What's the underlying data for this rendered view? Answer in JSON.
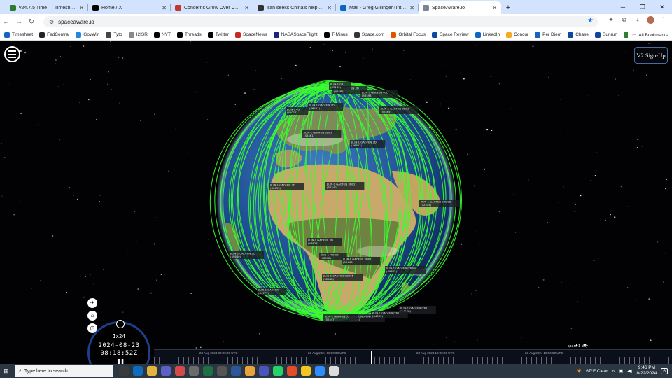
{
  "tabs": [
    {
      "title": "v24.7.5 Time — Timesheet for ",
      "color": "#2e7d32",
      "active": false
    },
    {
      "title": "Home / X",
      "color": "#000000",
      "active": false
    },
    {
      "title": "Concerns Grow Over Chinese S",
      "color": "#c0392b",
      "active": false
    },
    {
      "title": "Iran seeks China's help with su",
      "color": "#333333",
      "active": false
    },
    {
      "title": "Mail - Greg Gillinger (Integrity",
      "color": "#0a66c2",
      "active": false
    },
    {
      "title": "SpaceAware.io",
      "color": "#7a8599",
      "active": true
    }
  ],
  "address": {
    "url": "spaceaware.io"
  },
  "bookmarks": [
    {
      "label": "Timesheet",
      "color": "#1565c0"
    },
    {
      "label": "FedCentral",
      "color": "#222222"
    },
    {
      "label": "GovWin",
      "color": "#1e88e5"
    },
    {
      "label": "Tyto",
      "color": "#444444"
    },
    {
      "label": "I2ISR",
      "color": "#888888"
    },
    {
      "label": "NYT",
      "color": "#000000"
    },
    {
      "label": "Threads",
      "color": "#000000"
    },
    {
      "label": "Twitter",
      "color": "#000000"
    },
    {
      "label": "SpaceNews",
      "color": "#c62828"
    },
    {
      "label": "NASASpaceFlight",
      "color": "#1a237e"
    },
    {
      "label": "T-Minus",
      "color": "#000000"
    },
    {
      "label": "Space.com",
      "color": "#333333"
    },
    {
      "label": "Orbital Focus",
      "color": "#e65100"
    },
    {
      "label": "Space Review",
      "color": "#0d47a1"
    },
    {
      "label": "LinkedIn",
      "color": "#0a66c2"
    },
    {
      "label": "Concur",
      "color": "#f9a825"
    },
    {
      "label": "Per Diem",
      "color": "#1565c0"
    },
    {
      "label": "Chase",
      "color": "#0d47a1"
    },
    {
      "label": "Sunrun",
      "color": "#0d47a1"
    },
    {
      "label": "Edison",
      "color": "#2e7d32"
    }
  ],
  "all_bookmarks_label": "All Bookmarks",
  "app": {
    "signup_label": "V2 Sign-Up"
  },
  "clock": {
    "speed": "1x24",
    "date": "2024-08-23",
    "time": "08:18:52Z"
  },
  "timeline": {
    "labels": [
      "23 Aug 2024 00:00:00 UTC",
      "23 Aug 2024 06:00:00 UTC",
      "23 Aug 2024 12:00:00 UTC",
      "23 Aug 2024 18:00:00 UTC"
    ],
    "span_label": "span: 1 day"
  },
  "satellites": [
    {
      "name": "JILIN-1 GAOFEN 3D",
      "id": "(46453)"
    },
    {
      "name": "JILIN-1 GAOFEN 3D02",
      "id": "(54440)"
    },
    {
      "name": "JILIN-1 GAOFEN 03D08",
      "id": "(52445)"
    },
    {
      "name": "JILIN-1 GAOFEN 3D",
      "id": "(46462)"
    },
    {
      "name": "JILIN-1 GAOFEN 3D",
      "id": "(46461)"
    },
    {
      "name": "JILIN-1 GAOFEN 3D",
      "id": "(46657)"
    },
    {
      "name": "JILIN-1 GAOFEN 3D03",
      "id": "(46461)"
    },
    {
      "name": "JILIN-1 GAOFEN 3D03",
      "id": "(52465)"
    },
    {
      "name": "JILIN-1 GAOFEN 03D04",
      "id": "(49652)"
    },
    {
      "name": "JILIN-1 GAOFEN 3D",
      "id": "(44828)"
    },
    {
      "name": "JILIN-1 MO 03",
      "id": "(46578)"
    },
    {
      "name": "JILIN-1 GAOFEN 3D02",
      "id": "(52448)"
    },
    {
      "name": "JILIN-1 GAOFEN 03D05",
      "id": "(52448)"
    },
    {
      "name": "JILIN-1 GAOFEN 03D",
      "id": "(53593)"
    },
    {
      "name": "JILIN-1 GAOFEN 3D",
      "id": "(49640)"
    },
    {
      "name": "JILIN-1 GAOFEN 03D",
      "id": "(54038)"
    },
    {
      "name": "JILIN-1 GAOFEN 02A",
      "id": "(52446)"
    },
    {
      "name": "JILIN-1 GAOFEN 03",
      "id": "(52447)"
    },
    {
      "name": "JILIN-1 GAOFEN 03D",
      "id": "(54039)"
    },
    {
      "name": "JILIN-1 03",
      "id": "(43163)"
    },
    {
      "name": "JILIN-1 GAOFEN",
      "id": "(44777)"
    },
    {
      "name": "JILIN-1 03",
      "id": "(45017)"
    }
  ],
  "taskbar": {
    "search_placeholder": "Type here to search",
    "weather": "67°F  Clear",
    "time": "9:46 PM",
    "date": "8/22/2024",
    "notifications": "6"
  }
}
